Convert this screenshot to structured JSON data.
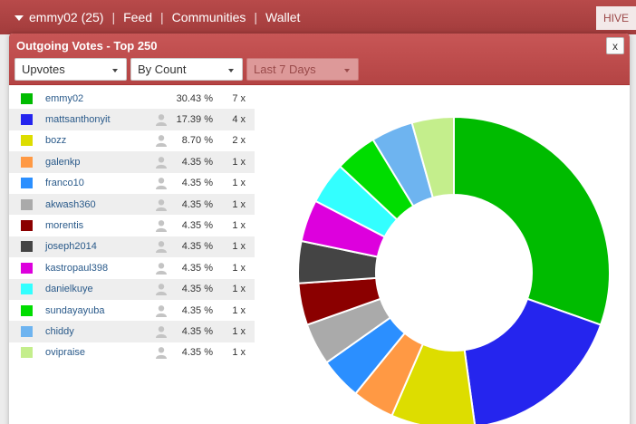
{
  "topbar": {
    "user": "emmy02 (25)",
    "links": [
      "Feed",
      "Communities",
      "Wallet"
    ],
    "separator": "|",
    "hive_label": "HIVE"
  },
  "panel": {
    "title": "Outgoing Votes - Top 250",
    "close_label": "x",
    "filters": [
      {
        "value": "Upvotes"
      },
      {
        "value": "By Count"
      },
      {
        "value": "Last 7 Days",
        "disabled": true
      }
    ]
  },
  "icons": {
    "person": "person-icon",
    "close": "close-icon",
    "dropdown": "caret-down-icon"
  },
  "rows": [
    {
      "name": "emmy02",
      "pct": "30.43 %",
      "count": "7 x",
      "color": "#00bb00",
      "person": false
    },
    {
      "name": "mattsanthonyit",
      "pct": "17.39 %",
      "count": "4 x",
      "color": "#2525ee",
      "person": true
    },
    {
      "name": "bozz",
      "pct": "8.70 %",
      "count": "2 x",
      "color": "#dddd00",
      "person": true
    },
    {
      "name": "galenkp",
      "pct": "4.35 %",
      "count": "1 x",
      "color": "#ff9944",
      "person": true
    },
    {
      "name": "franco10",
      "pct": "4.35 %",
      "count": "1 x",
      "color": "#2b8fff",
      "person": true
    },
    {
      "name": "akwash360",
      "pct": "4.35 %",
      "count": "1 x",
      "color": "#aaaaaa",
      "person": true
    },
    {
      "name": "morentis",
      "pct": "4.35 %",
      "count": "1 x",
      "color": "#8b0000",
      "person": true
    },
    {
      "name": "joseph2014",
      "pct": "4.35 %",
      "count": "1 x",
      "color": "#444444",
      "person": true
    },
    {
      "name": "kastropaul398",
      "pct": "4.35 %",
      "count": "1 x",
      "color": "#dd00dd",
      "person": true
    },
    {
      "name": "danielkuye",
      "pct": "4.35 %",
      "count": "1 x",
      "color": "#33ffff",
      "person": true
    },
    {
      "name": "sundayayuba",
      "pct": "4.35 %",
      "count": "1 x",
      "color": "#00dd00",
      "person": true
    },
    {
      "name": "chiddy",
      "pct": "4.35 %",
      "count": "1 x",
      "color": "#6eb4f0",
      "person": true
    },
    {
      "name": "ovipraise",
      "pct": "4.35 %",
      "count": "1 x",
      "color": "#c4ee8c",
      "person": true
    }
  ],
  "chart_data": {
    "type": "pie",
    "variant": "donut",
    "labels": [
      "emmy02",
      "mattsanthonyit",
      "bozz",
      "galenkp",
      "franco10",
      "akwash360",
      "morentis",
      "joseph2014",
      "kastropaul398",
      "danielkuye",
      "sundayayuba",
      "chiddy",
      "ovipraise"
    ],
    "values": [
      7,
      4,
      2,
      1,
      1,
      1,
      1,
      1,
      1,
      1,
      1,
      1,
      1
    ],
    "colors": [
      "#00bb00",
      "#2525ee",
      "#dddd00",
      "#ff9944",
      "#2b8fff",
      "#aaaaaa",
      "#8b0000",
      "#444444",
      "#dd00dd",
      "#33ffff",
      "#00dd00",
      "#6eb4f0",
      "#c4ee8c"
    ]
  }
}
